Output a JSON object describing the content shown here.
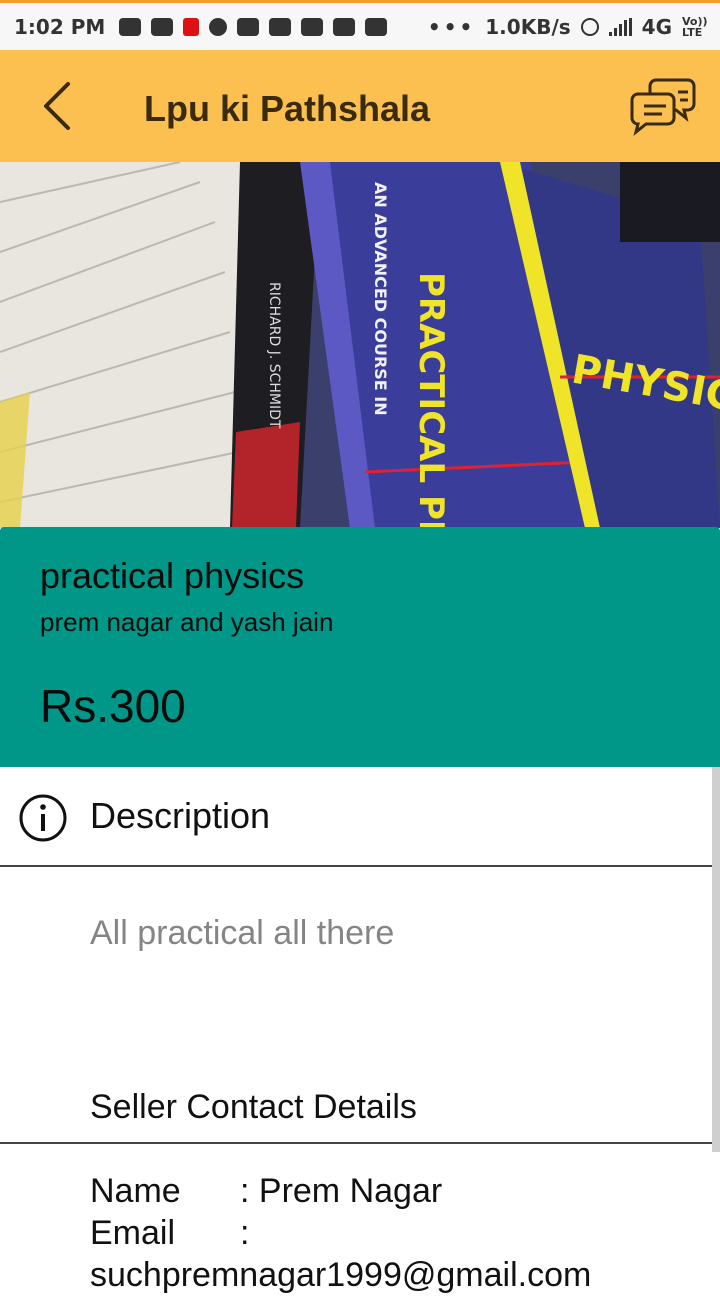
{
  "status_bar": {
    "time": "1:02 PM",
    "speed": "1.0KB/s",
    "network": "4G",
    "volte": "Vo)) LTE",
    "more": "•••"
  },
  "app_bar": {
    "title": "Lpu ki Pathshala",
    "accent_color": "#fbc04f"
  },
  "product": {
    "name": "practical physics",
    "author": "prem nagar and yash jain",
    "price": "Rs.300",
    "card_color": "#009688",
    "cover_texts": [
      "AN ADVANCED COURSE IN",
      "PRACTICAL PHYSICS",
      "PHYSICS",
      "RICHARD J. SCHMIDT"
    ]
  },
  "description": {
    "label": "Description",
    "text": "All practical all there"
  },
  "seller": {
    "heading": "Seller Contact Details",
    "name_key": "Name",
    "name_value": ": Prem Nagar",
    "email_key": "Email",
    "email_value": ":",
    "email_address": "suchpremnagar1999@gmail.com"
  }
}
